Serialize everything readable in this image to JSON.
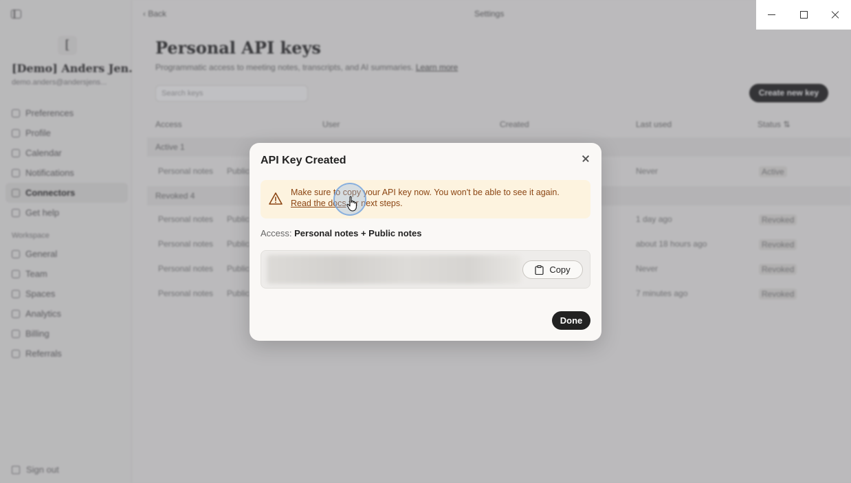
{
  "sidebar": {
    "workspace_initial": "[",
    "workspace_name": "[Demo] Anders Jen...",
    "workspace_email": "demo.anders@andersjens...",
    "items": [
      {
        "label": "Preferences"
      },
      {
        "label": "Profile"
      },
      {
        "label": "Calendar"
      },
      {
        "label": "Notifications"
      },
      {
        "label": "Connectors"
      },
      {
        "label": "Get help"
      }
    ],
    "workspace_section": "Workspace",
    "workspace_items": [
      {
        "label": "General"
      },
      {
        "label": "Team"
      },
      {
        "label": "Spaces"
      },
      {
        "label": "Analytics"
      },
      {
        "label": "Billing"
      },
      {
        "label": "Referrals"
      }
    ],
    "sign_out": "Sign out"
  },
  "topbar": {
    "back": "Back",
    "title": "Settings"
  },
  "page": {
    "title": "Personal API keys",
    "subtitle": "Programmatic access to meeting notes, transcripts, and AI summaries.",
    "learn_more": "Learn more",
    "search_placeholder": "Search keys",
    "create_button": "Create new key",
    "columns": [
      "Access",
      "User",
      "Created",
      "Last used",
      "Status"
    ],
    "active_group": "Active",
    "active_count": "1",
    "revoked_group": "Revoked",
    "revoked_count": "4",
    "active_rows": [
      {
        "access": "Personal notes",
        "access2": "Public",
        "last_used": "Never",
        "status": "Active"
      }
    ],
    "revoked_rows": [
      {
        "access": "Personal notes",
        "access2": "Public",
        "last_used": "1 day ago",
        "status": "Revoked"
      },
      {
        "access": "Personal notes",
        "access2": "Public",
        "last_used": "about 18 hours ago",
        "status": "Revoked"
      },
      {
        "access": "Personal notes",
        "access2": "Public",
        "last_used": "Never",
        "status": "Revoked"
      },
      {
        "access": "Personal notes",
        "access2": "Public",
        "last_used": "7 minutes ago",
        "status": "Revoked"
      }
    ]
  },
  "modal": {
    "title": "API Key Created",
    "warning_line1": "Make sure to copy your API key now. You won't be able to see it again.",
    "warning_link": "Read the docs",
    "warning_line2_suffix": " for next steps.",
    "access_label": "Access:",
    "access_value": "Personal notes + Public notes",
    "copy_label": "Copy",
    "done_label": "Done"
  },
  "colors": {
    "warning_bg": "#fdf3df",
    "warning_text": "#8b4513",
    "primary_button": "#222222"
  }
}
